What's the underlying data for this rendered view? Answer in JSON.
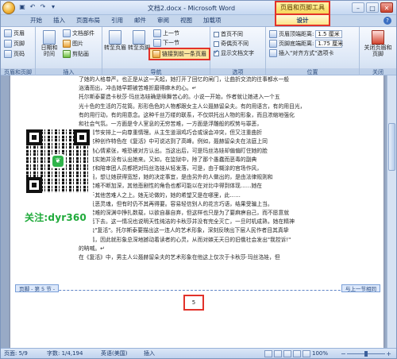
{
  "window": {
    "title": "文档2.docx - Microsoft Word",
    "context_tool_title": "页眉和页脚工具",
    "controls": {
      "minimize": "–",
      "maximize": "□",
      "close": "✕"
    }
  },
  "tabs": [
    "开始",
    "插入",
    "页面布局",
    "引用",
    "邮件",
    "审阅",
    "视图",
    "加载项"
  ],
  "design_tab": "设计",
  "ribbon": {
    "groups": {
      "header_footer": {
        "label": "页眉和页脚",
        "header": "页眉",
        "footer": "页脚",
        "page_number": "页码"
      },
      "insert": {
        "label": "插入",
        "date_time": "日期和时间",
        "doc_parts": "文档部件",
        "picture": "图片",
        "clip_art": "剪贴画"
      },
      "navigation": {
        "label": "导航",
        "goto_header": "转至页眉",
        "goto_footer": "转至页脚",
        "previous": "上一节",
        "next": "下一节",
        "link_previous": "链接到前一条页眉"
      },
      "options": {
        "label": "选项",
        "different_first": "首页不同",
        "odd_even": "奇偶页不同",
        "show_text": "显示文档文字"
      },
      "position": {
        "label": "位置",
        "header_top": "页眉顶端距离:",
        "header_top_value": "1.5 厘米",
        "footer_bottom": "页脚底端距离:",
        "footer_bottom_value": "1.75 厘米",
        "insert_align": "插入\"对齐方式\"选项卡"
      },
      "close": {
        "label": "关闭",
        "close_hf": "关闭页眉和页脚"
      }
    }
  },
  "document": {
    "paragraphs": [
      "了她的人格尊严。也正是从这一天起，她打开了回忆的闸门，让曲折交流的往事都水一般",
      "汹涌而出，冲击她早颗被苦难折磨得麻木的心。↵",
      "托尔斯泰要造卡秋莎·玛丝洛娃确是赎舞苦心的。小说一开始，作者就让她进入一个五",
      "光十色的生活的万花筒。形形色色的人物都跟女主人公聂赫留朵夫。有的用语言，有的用目光，",
      "有的用行动，有的用意念。这种千丝万缕的联系，不仅烘托出人物的形象，而且浓缩地强化",
      "和社会气氛。一方面是令人室息的无穷苦难，一方面是浮雕般的权势与罪恶，",
      "泰在情节安排上一向尊重情理。从主生道溺鸡巧合或误会冲突，但又注重曲折",
      "她，这种创作特色在《复活》中可说达到了高峰。例如，聂赫留朵夫在法庭上同",
      "隔，她心情紧张，唯恐被对方认出。当这出后，可是玛丝洛娃却偏偏盯住她的脸",
      "光，其实她并没有认出她来。又如，在监狱中，除了那个愚蠢而恶毒的副典",
      "讼法官和陪审团人员都把对玛丝洛娃从轻发落，可是，由于糊涂的官场作风，",
      "表不同，想让她获得宽恕，她的决定事宜，是由另外的人做出的，是由法律规则和",
      "城的苦难不断加深，其他悲剧性的角色也都可能以在对比中得到体现……她在",
      "邀出于其他苦难人之上。她无论做的，她的希望又是在哪里，此……",
      "物的丑恶灵魂，但有时仍不其再得要。容易轻信别人的花言巧语，结果受骗上当。",
      "她在苦难的深渊中挣扎数载，以欲自暴自弃，但这样也只是为了要麻痹自己，而不愿意就",
      "活生活下去。这一情况也说明天性纯洁的卡秋莎并没有完全灭亡，一旦时机成熟，她在精神",
      "上就会\"复活\"。托尔斯泰要描出这一连人的艺术形象，深刻反映出下层人民作者目其真挚",
      "的悟情，因此就形象总深地撼动着读者的心灵，从而对嫉无天日的旧俄社会发出\"我控诉!\"",
      "的呐喊。↵",
      "在《复活》中，男主人公聂赫留朵夫的艺术形象在他这上仅次于卡秋莎·玛丝洛娃，但"
    ],
    "watermark": "关注:dyr360",
    "footer_left_tag": "页脚 - 第 5 节 -",
    "footer_right_tag": "与上一节相同",
    "footer_page_num": "5"
  },
  "statusbar": {
    "page": "页面: 5/9",
    "words": "字数: 1/4,194",
    "lang": "英语(美国)",
    "mode": "插入",
    "zoom": "100%"
  },
  "colors": {
    "accent_red": "#e2322a",
    "ribbon_blue": "#dce7f6",
    "watermark_green": "#1faa3a"
  }
}
